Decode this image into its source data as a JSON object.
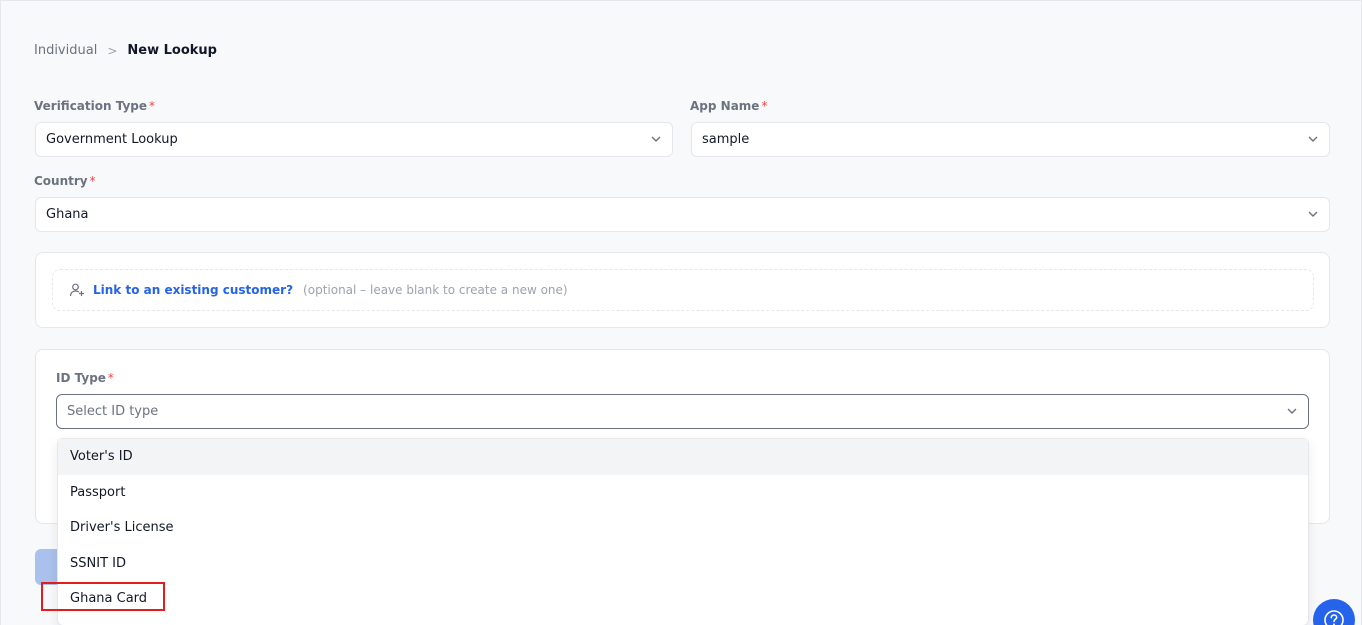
{
  "breadcrumb": {
    "parent": "Individual",
    "separator": ">",
    "current": "New Lookup"
  },
  "form": {
    "verification_type": {
      "label": "Verification Type",
      "required": "*",
      "value": "Government Lookup"
    },
    "app_name": {
      "label": "App Name",
      "required": "*",
      "value": "sample"
    },
    "country": {
      "label": "Country",
      "required": "*",
      "value": "Ghana"
    },
    "link_customer": {
      "link": "Link to an existing customer?",
      "hint": "(optional – leave blank to create a new one)"
    },
    "id_type": {
      "label": "ID Type",
      "required": "*",
      "placeholder": "Select ID type",
      "options": [
        "Voter's ID",
        "Passport",
        "Driver's License",
        "SSNIT ID",
        "Ghana Card"
      ]
    }
  },
  "colors": {
    "accent": "#2563eb",
    "required": "#ef4444",
    "highlight": "#e11d1d"
  }
}
